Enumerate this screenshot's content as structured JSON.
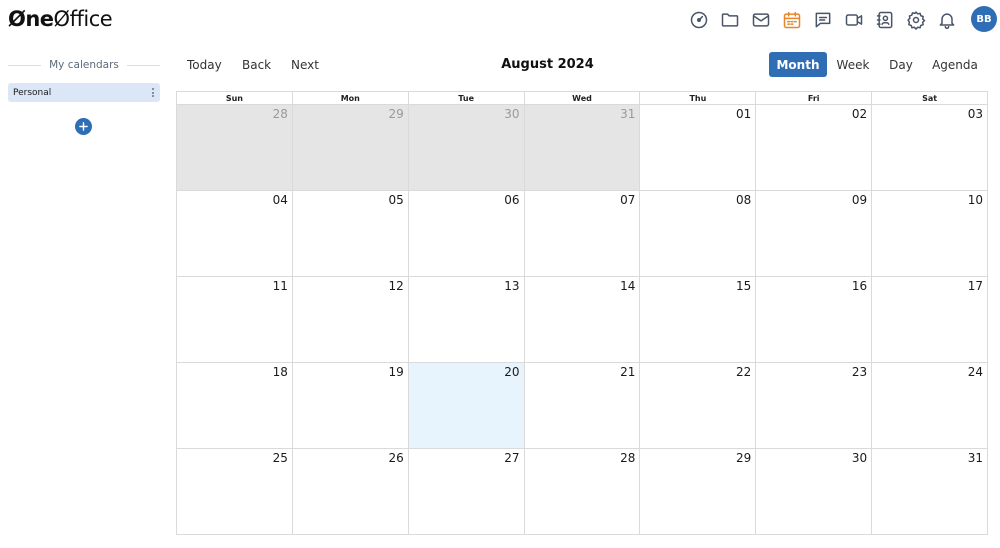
{
  "app": {
    "logo_bold": "Øne",
    "logo_light": "Øffice"
  },
  "header": {
    "icons": [
      "dashboard-icon",
      "folder-icon",
      "mail-icon",
      "calendar-icon",
      "chat-icon",
      "video-icon",
      "contacts-icon",
      "gear-icon",
      "bell-icon"
    ],
    "active_icon": "calendar-icon",
    "active_color": "#e8862a",
    "icon_color": "#4a5568",
    "avatar_initials": "BB",
    "avatar_color": "#2f6db5"
  },
  "sidebar": {
    "title": "My calendars",
    "calendars": [
      {
        "label": "Personal"
      }
    ]
  },
  "toolbar": {
    "today_label": "Today",
    "back_label": "Back",
    "next_label": "Next",
    "month_title": "August 2024",
    "views": [
      "Month",
      "Week",
      "Day",
      "Agenda"
    ],
    "active_view": "Month"
  },
  "calendar": {
    "weekdays": [
      "Sun",
      "Mon",
      "Tue",
      "Wed",
      "Thu",
      "Fri",
      "Sat"
    ],
    "weeks": [
      [
        {
          "d": "28",
          "off": true
        },
        {
          "d": "29",
          "off": true
        },
        {
          "d": "30",
          "off": true
        },
        {
          "d": "31",
          "off": true
        },
        {
          "d": "01"
        },
        {
          "d": "02"
        },
        {
          "d": "03"
        }
      ],
      [
        {
          "d": "04"
        },
        {
          "d": "05"
        },
        {
          "d": "06"
        },
        {
          "d": "07"
        },
        {
          "d": "08"
        },
        {
          "d": "09"
        },
        {
          "d": "10"
        }
      ],
      [
        {
          "d": "11"
        },
        {
          "d": "12"
        },
        {
          "d": "13"
        },
        {
          "d": "14"
        },
        {
          "d": "15"
        },
        {
          "d": "16"
        },
        {
          "d": "17"
        }
      ],
      [
        {
          "d": "18"
        },
        {
          "d": "19"
        },
        {
          "d": "20",
          "today": true
        },
        {
          "d": "21"
        },
        {
          "d": "22"
        },
        {
          "d": "23"
        },
        {
          "d": "24"
        }
      ],
      [
        {
          "d": "25"
        },
        {
          "d": "26"
        },
        {
          "d": "27"
        },
        {
          "d": "28"
        },
        {
          "d": "29"
        },
        {
          "d": "30"
        },
        {
          "d": "31"
        }
      ]
    ]
  }
}
